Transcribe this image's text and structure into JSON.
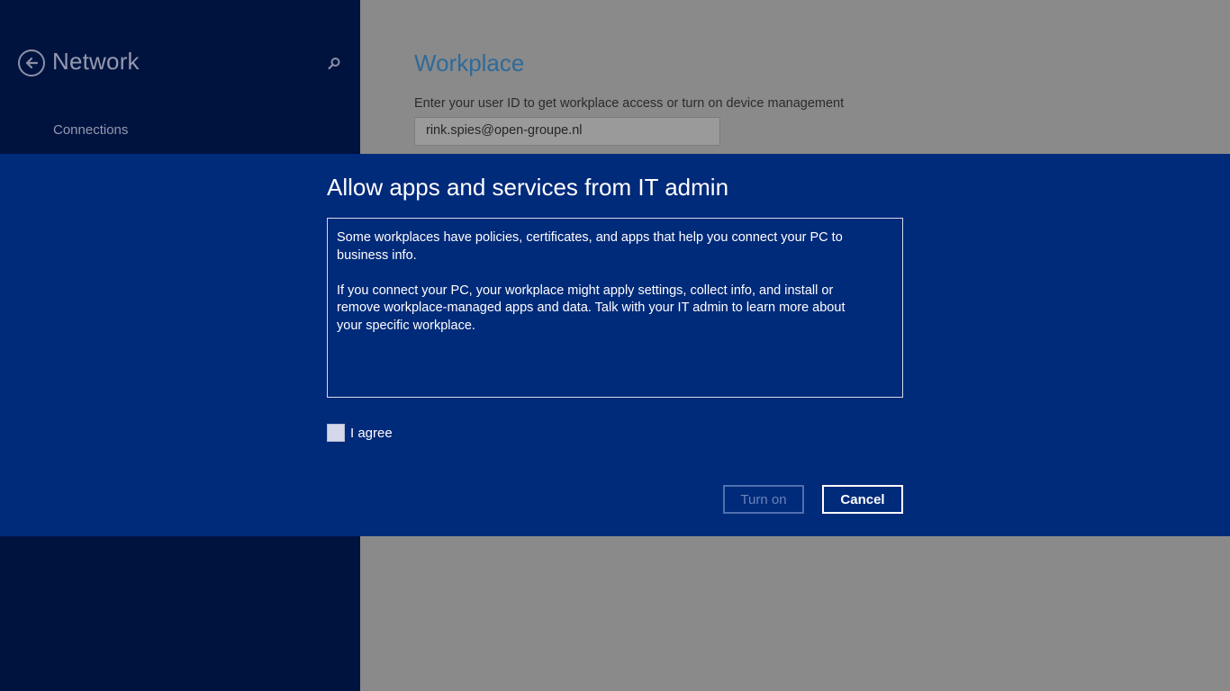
{
  "sidebar": {
    "title": "Network",
    "items": [
      {
        "label": "Connections"
      }
    ],
    "icons": {
      "back": "back-arrow-circle-icon",
      "search": "search-icon"
    }
  },
  "main": {
    "title": "Workplace",
    "description": "Enter your user ID to get workplace access or turn on device management",
    "user_id_value": "rink.spies@open-groupe.nl"
  },
  "dialog": {
    "title": "Allow apps and services from IT admin",
    "paragraphs": [
      "Some workplaces have policies, certificates, and apps that help you connect your PC to business info.",
      "If you connect your PC, your workplace might apply settings, collect info, and install or remove workplace-managed apps and data. Talk with your IT admin to learn more about your specific workplace."
    ],
    "agree_label": "I agree",
    "agree_checked": false,
    "turn_on_label": "Turn on",
    "turn_on_enabled": false,
    "cancel_label": "Cancel"
  },
  "colors": {
    "sidebar_bg": "#00133f",
    "dialog_bg": "#002a7a",
    "dimmed_bg": "#8a8a8a",
    "title_accent": "#2f6a98"
  }
}
